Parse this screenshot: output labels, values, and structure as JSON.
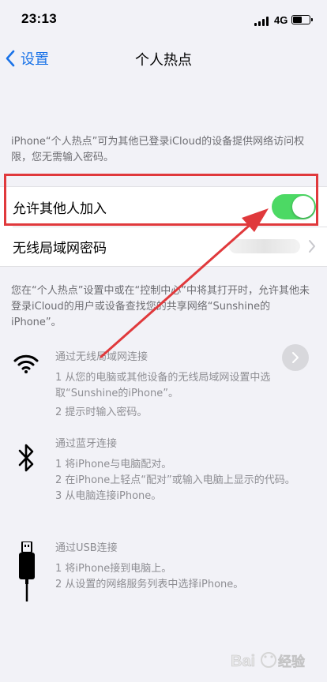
{
  "status_bar": {
    "time": "23:13",
    "network": "4G"
  },
  "nav": {
    "back_label": "设置",
    "title": "个人热点"
  },
  "description_top": "iPhone“个人热点”可为其他已登录iCloud的设备提供网络访问权限，您无需输入密码。",
  "settings": {
    "allow_others_label": "允许其他人加入",
    "allow_others_on": true,
    "wifi_password_label": "无线局域网密码"
  },
  "description_mid": "您在“个人热点”设置中或在“控制中心”中将其打开时，允许其他未登录iCloud的用户或设备查找您的共享网络“Sunshine的iPhone”。",
  "sections": [
    {
      "icon": "wifi-icon",
      "title": "通过无线局域网连接",
      "steps": [
        "1 从您的电脑或其他设备的无线局域网设置中选取“Sunshine的iPhone”。",
        "2 提示时输入密码。"
      ]
    },
    {
      "icon": "bluetooth-icon",
      "title": "通过蓝牙连接",
      "steps": [
        "1 将iPhone与电脑配对。",
        "2 在iPhone上轻点“配对”或输入电脑上显示的代码。",
        "3 从电脑连接iPhone。"
      ]
    },
    {
      "icon": "usb-cable-icon",
      "title": "通过USB连接",
      "steps": [
        "1 将iPhone接到电脑上。",
        "2 从设置的网络服务列表中选择iPhone。"
      ]
    }
  ],
  "annotation": {
    "highlight_color": "#e0393c"
  },
  "accent": {
    "link": "#1a73e8",
    "toggle_on": "#4cd964"
  },
  "watermark": {
    "text": "Bai经验"
  }
}
